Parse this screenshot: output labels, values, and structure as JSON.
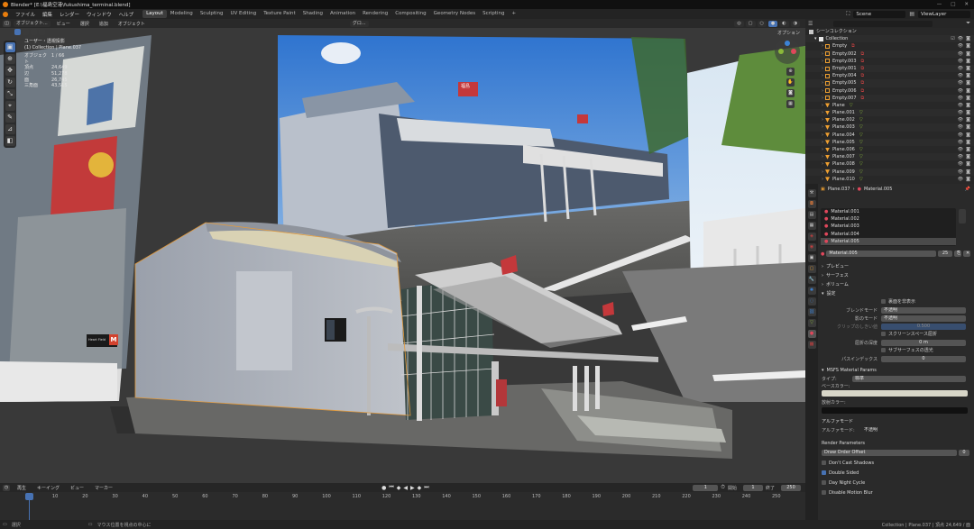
{
  "window": {
    "title": "Blender* [E:\\福島空港\\fukushima_terminal.blend]",
    "controls": [
      "—",
      "□",
      "✕"
    ]
  },
  "menu": [
    "ファイル",
    "編集",
    "レンダー",
    "ウィンドウ",
    "ヘルプ"
  ],
  "workspaces": [
    "Layout",
    "Modeling",
    "Sculpting",
    "UV Editing",
    "Texture Paint",
    "Shading",
    "Animation",
    "Rendering",
    "Compositing",
    "Geometry Nodes",
    "Scripting",
    "+"
  ],
  "active_workspace": "Layout",
  "scene": {
    "name": "Scene",
    "view_layer": "ViewLayer"
  },
  "viewport": {
    "header": {
      "mode": "オブジェクト...",
      "menus": [
        "ビュー",
        "選択",
        "追加",
        "オブジェクト"
      ],
      "transform": "グロ...",
      "options": "オプション"
    },
    "stats": {
      "title": "ユーザー・透視投影",
      "collection": "(1) Collection | Plane.037",
      "rows": [
        {
          "k": "オブジェクト",
          "v": "1 / 66"
        },
        {
          "k": "頂点",
          "v": "24,649"
        },
        {
          "k": "辺",
          "v": "51,278"
        },
        {
          "k": "面",
          "v": "26,745"
        },
        {
          "k": "三角面",
          "v": "43,515"
        }
      ]
    },
    "tools": [
      "select-box-icon",
      "cursor-icon",
      "move-icon",
      "rotate-icon",
      "scale-icon",
      "transform-icon",
      "annotate-icon",
      "measure-icon",
      "add-cube-icon"
    ],
    "tool_glyphs": [
      "▣",
      "⊕",
      "✥",
      "↻",
      "⤡",
      "⌖",
      "✎",
      "⊿",
      "◧"
    ],
    "sign_m": "M",
    "sign_kanji": "福島",
    "sign_text": "Heart Field"
  },
  "timeline": {
    "menus": [
      "再生",
      "キーイング",
      "ビュー",
      "マーカー"
    ],
    "current": "1",
    "start_label": "開始",
    "start": "1",
    "end_label": "終了",
    "end": "250",
    "ticks": [
      "1",
      "10",
      "20",
      "30",
      "40",
      "50",
      "60",
      "70",
      "80",
      "90",
      "100",
      "110",
      "120",
      "130",
      "140",
      "150",
      "160",
      "170",
      "180",
      "190",
      "200",
      "210",
      "220",
      "230",
      "240",
      "250"
    ]
  },
  "statusbar": {
    "left": "選択",
    "middle": "マウス位置を視点の中心に",
    "right": "Collection | Plane.037 | 頂点 24,649 / 面"
  },
  "outliner": {
    "root": "シーンコレクション",
    "collection": "Collection",
    "items": [
      {
        "name": "Empty",
        "type": "empty"
      },
      {
        "name": "Empty.002",
        "type": "empty"
      },
      {
        "name": "Empty.003",
        "type": "empty"
      },
      {
        "name": "Empty.001",
        "type": "empty"
      },
      {
        "name": "Empty.004",
        "type": "empty"
      },
      {
        "name": "Empty.005",
        "type": "empty"
      },
      {
        "name": "Empty.006",
        "type": "empty"
      },
      {
        "name": "Empty.007",
        "type": "empty"
      },
      {
        "name": "Plane",
        "type": "mesh"
      },
      {
        "name": "Plane.001",
        "type": "mesh"
      },
      {
        "name": "Plane.002",
        "type": "mesh"
      },
      {
        "name": "Plane.003",
        "type": "mesh"
      },
      {
        "name": "Plane.004",
        "type": "mesh"
      },
      {
        "name": "Plane.005",
        "type": "mesh"
      },
      {
        "name": "Plane.006",
        "type": "mesh"
      },
      {
        "name": "Plane.007",
        "type": "mesh"
      },
      {
        "name": "Plane.008",
        "type": "mesh"
      },
      {
        "name": "Plane.009",
        "type": "mesh"
      },
      {
        "name": "Plane.010",
        "type": "mesh"
      }
    ]
  },
  "properties": {
    "breadcrumb_object": "Plane.037",
    "breadcrumb_material": "Material.005",
    "slots": [
      "Material.001",
      "Material.002",
      "Material.003",
      "Material.004",
      "Material.005"
    ],
    "active_slot": "Material.005",
    "material_name": "Material.005",
    "users": "25",
    "sections": [
      "プレビュー",
      "サーフェス",
      "ボリューム",
      "設定"
    ],
    "settings": {
      "backface_label": "裏面を非表示",
      "blend_mode_label": "ブレンドモード",
      "blend_mode": "不透明",
      "shadow_mode_label": "影のモード",
      "shadow_mode": "不透明",
      "clip_label": "クリップのしきい値",
      "clip_value": "0.500",
      "ssr_label": "スクリーンスペース屈折",
      "refraction_label": "屈折の深度",
      "refraction_value": "0 m",
      "subsurface_label": "サブサーフェスの透光",
      "pass_index_label": "パスインデックス",
      "pass_index": "0"
    },
    "msfs": {
      "title": "MSFS Material Params",
      "type_label": "タイプ:",
      "type_value": "標準",
      "base_color_label": "ベースカラー:",
      "emissive_label": "放射カラー:",
      "alpha_title": "アルファモード",
      "alpha_label": "アルファモード:",
      "alpha_value": "不透明",
      "render_title": "Render Parameters",
      "draw_order": "Draw Order Offset",
      "draw_order_value": "0",
      "checks": [
        {
          "label": "Don't Cast Shadows",
          "on": false
        },
        {
          "label": "Double Sided",
          "on": true
        },
        {
          "label": "Day Night Cycle",
          "on": false
        },
        {
          "label": "Disable Motion Blur",
          "on": false
        }
      ]
    }
  },
  "colors": {
    "accent": "#4772b3",
    "active_orange": "#e87d0d",
    "sky": "#3d7fd1",
    "base_color": "#d8d6c8",
    "emissive_color": "#111111"
  }
}
